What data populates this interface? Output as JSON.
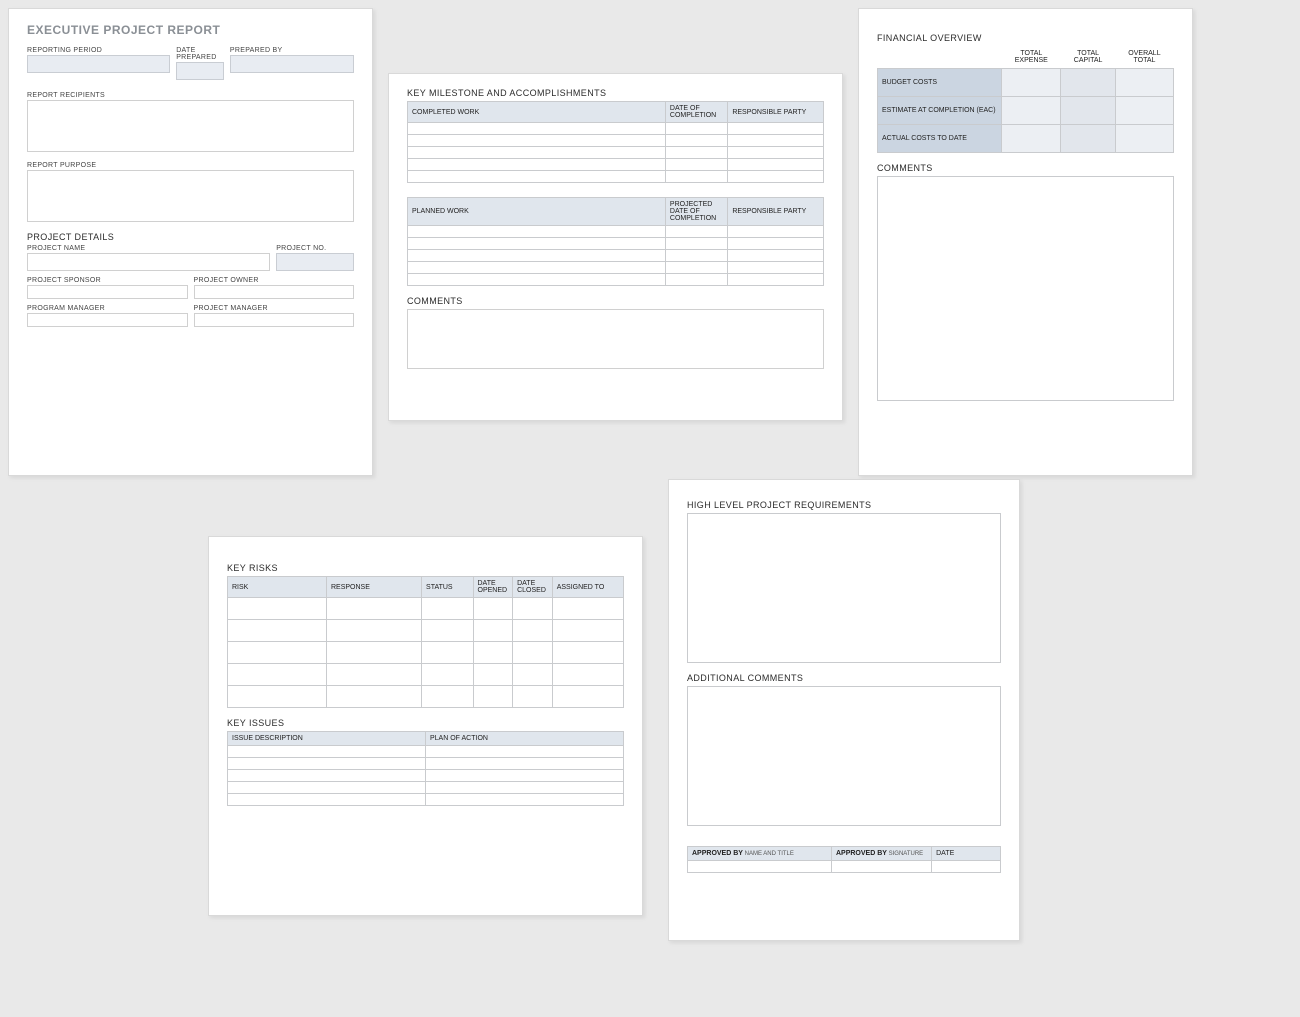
{
  "page1": {
    "title": "EXECUTIVE PROJECT REPORT",
    "labels": {
      "reporting_period": "REPORTING PERIOD",
      "date_prepared": "DATE PREPARED",
      "prepared_by": "PREPARED BY",
      "report_recipients": "REPORT RECIPIENTS",
      "report_purpose": "REPORT PURPOSE",
      "project_details": "PROJECT DETAILS",
      "project_name": "PROJECT NAME",
      "project_no": "PROJECT NO.",
      "project_sponsor": "PROJECT SPONSOR",
      "project_owner": "PROJECT OWNER",
      "program_manager": "PROGRAM MANAGER",
      "project_manager": "PROJECT MANAGER"
    }
  },
  "page2": {
    "title": "KEY MILESTONE AND ACCOMPLISHMENTS",
    "completed_headers": {
      "work": "COMPLETED WORK",
      "date": "DATE OF COMPLETION",
      "party": "RESPONSIBLE PARTY"
    },
    "planned_headers": {
      "work": "PLANNED WORK",
      "date": "PROJECTED DATE OF COMPLETION",
      "party": "RESPONSIBLE PARTY"
    },
    "comments_label": "COMMENTS"
  },
  "page3": {
    "title": "FINANCIAL OVERVIEW",
    "col_headers": {
      "expense": "TOTAL EXPENSE",
      "capital": "TOTAL CAPITAL",
      "overall": "OVERALL TOTAL"
    },
    "rows": {
      "budget": "BUDGET COSTS",
      "eac": "ESTIMATE AT COMPLETION (EAC)",
      "actual": "ACTUAL COSTS TO DATE"
    },
    "comments_label": "COMMENTS"
  },
  "page4": {
    "risks_title": "KEY RISKS",
    "risk_headers": {
      "risk": "RISK",
      "response": "RESPONSE",
      "status": "STATUS",
      "opened": "DATE OPENED",
      "closed": "DATE CLOSED",
      "assigned": "ASSIGNED TO"
    },
    "issues_title": "KEY ISSUES",
    "issue_headers": {
      "desc": "ISSUE DESCRIPTION",
      "plan": "PLAN OF ACTION"
    }
  },
  "page5": {
    "req_title": "HIGH LEVEL PROJECT REQUIREMENTS",
    "add_comments": "ADDITIONAL COMMENTS",
    "approved_by": "APPROVED BY",
    "approved_by_sub": " NAME AND TITLE",
    "approved_sig": "APPROVED BY",
    "approved_sig_sub": " SIGNATURE",
    "date": "DATE"
  }
}
